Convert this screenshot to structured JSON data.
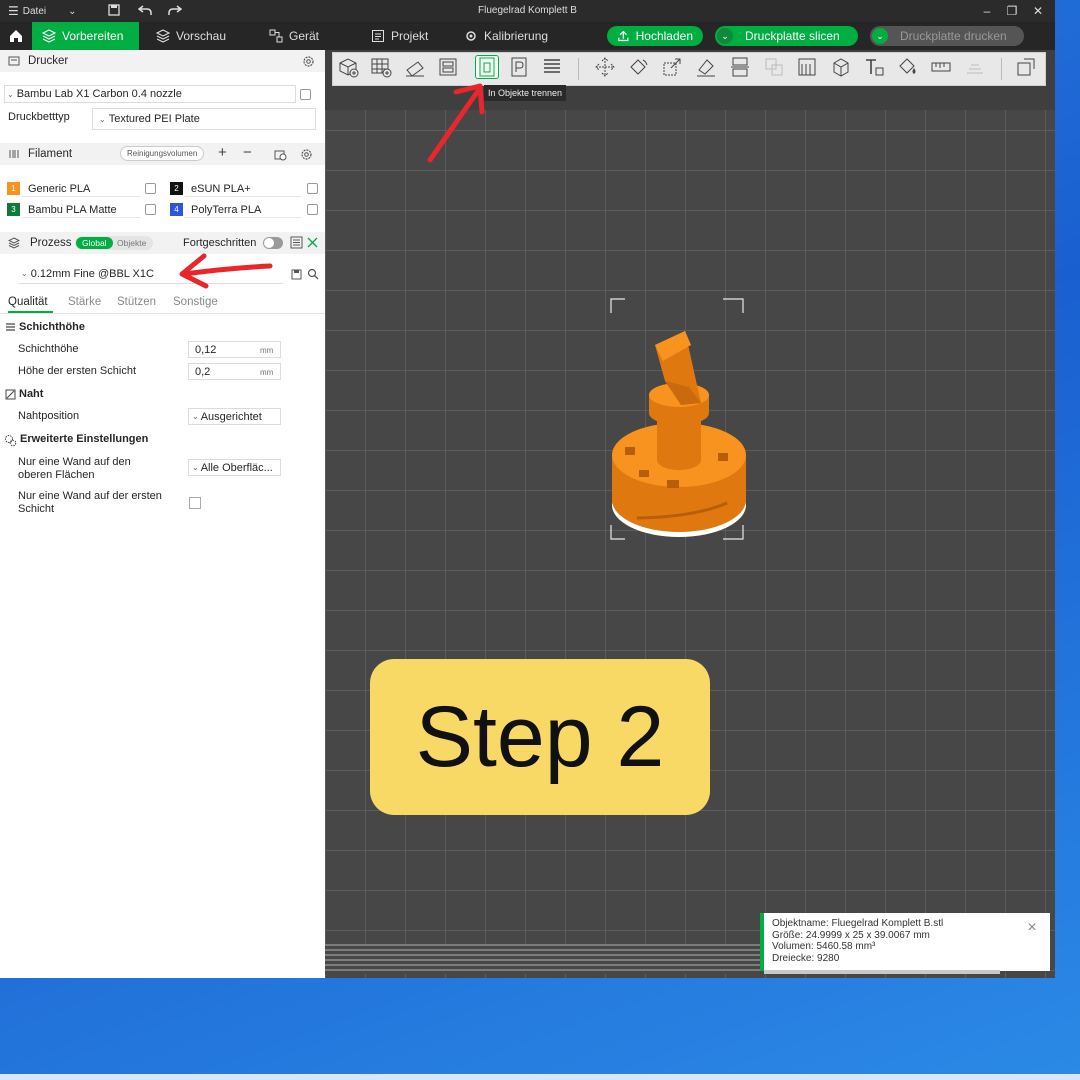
{
  "titlebar": {
    "menu_label": "Datei",
    "window_title": "Fluegelrad Komplett B",
    "minimize": "–",
    "maximize": "❐",
    "close": "✕"
  },
  "nav": {
    "tabs": [
      {
        "label": "Vorbereiten",
        "icon": "layers-icon",
        "active": true
      },
      {
        "label": "Vorschau",
        "icon": "stack-icon"
      },
      {
        "label": "Gerät",
        "icon": "device-icon"
      },
      {
        "label": "Projekt",
        "icon": "project-icon"
      },
      {
        "label": "Kalibrierung",
        "icon": "calibrate-icon"
      }
    ],
    "upload_label": "Hochladen",
    "slice_label": "Druckplatte slicen",
    "print_label": "Druckplatte drucken"
  },
  "printer": {
    "section_title": "Drucker",
    "printer_value": "Bambu Lab X1 Carbon 0.4 nozzle",
    "bed_label": "Druckbetttyp",
    "bed_value": "Textured PEI Plate"
  },
  "filament": {
    "section_title": "Filament",
    "flush_label": "Reinigungsvolumen",
    "items": [
      {
        "num": "1",
        "name": "Generic PLA",
        "color": "#f7931e"
      },
      {
        "num": "2",
        "name": "eSUN PLA+",
        "color": "#111111"
      },
      {
        "num": "3",
        "name": "Bambu PLA Matte",
        "color": "#0d7a3a"
      },
      {
        "num": "4",
        "name": "PolyTerra PLA",
        "color": "#2f56d6"
      }
    ]
  },
  "process": {
    "section_title": "Prozess",
    "global_label": "Global",
    "objects_label": "Objekte",
    "advanced_label": "Fortgeschritten",
    "preset_value": "0.12mm Fine @BBL X1C",
    "tabs": [
      "Qualität",
      "Stärke",
      "Stützen",
      "Sonstige"
    ],
    "groups": {
      "layer_height_title": "Schichthöhe",
      "layer_height_label": "Schichthöhe",
      "layer_height_value": "0,12",
      "first_layer_label": "Höhe der ersten Schicht",
      "first_layer_value": "0,2",
      "unit": "mm",
      "seam_title": "Naht",
      "seam_label": "Nahtposition",
      "seam_value": "Ausgerichtet",
      "advanced_title": "Erweiterte Einstellungen",
      "one_wall_top_label_1": "Nur eine Wand auf den",
      "one_wall_top_label_2": "oberen Flächen",
      "one_wall_top_value": "Alle Oberfläc...",
      "one_wall_first_label_1": "Nur eine Wand auf der ersten",
      "one_wall_first_label_2": "Schicht"
    }
  },
  "canvas": {
    "tooltip": "In Objekte trennen",
    "step_label": "Step 2",
    "info": {
      "name_line": "Objektname: Fluegelrad Komplett B.stl",
      "size_line": "Größe: 24.9999 x 25 x 39.0067 mm",
      "volume_line": "Volumen: 5460.58 mm³",
      "triangles_line": "Dreiecke: 9280"
    }
  },
  "colors": {
    "accent": "#00ae42",
    "model": "#f7931e",
    "annotation": "#e8262b",
    "step_box": "#f9d966"
  }
}
